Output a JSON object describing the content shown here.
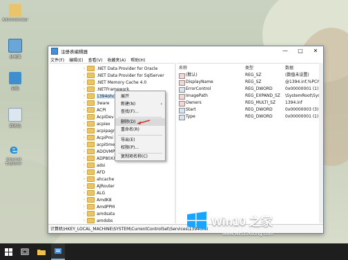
{
  "desktop": {
    "icons": [
      {
        "label": "Administrator"
      },
      {
        "label": "此电脑"
      },
      {
        "label": "网络"
      },
      {
        "label": "回收站"
      },
      {
        "label": "Internet Explorer"
      }
    ]
  },
  "window": {
    "title": "注册表编辑器",
    "controls": {
      "minimize": "—",
      "maximize": "□",
      "close": "✕"
    },
    "menu": [
      "文件(F)",
      "编辑(E)",
      "查看(V)",
      "收藏夹(A)",
      "帮助(H)"
    ]
  },
  "tree": {
    "items": [
      {
        "label": ".NET Data Provider for Oracle",
        "selected": false
      },
      {
        "label": ".NET Data Provider for SqlServer",
        "selected": false
      },
      {
        "label": ".NET Memory Cache 4.0",
        "selected": false
      },
      {
        "label": ".NETFramework",
        "selected": false
      },
      {
        "label": "1394ohci",
        "selected": true
      },
      {
        "label": "3ware",
        "selected": false
      },
      {
        "label": "ACPI",
        "selected": false
      },
      {
        "label": "AcpiDev",
        "selected": false
      },
      {
        "label": "acpiex",
        "selected": false
      },
      {
        "label": "acpipagr",
        "selected": false
      },
      {
        "label": "AcpiPmi",
        "selected": false
      },
      {
        "label": "acpitime",
        "selected": false
      },
      {
        "label": "ADOVMP",
        "selected": false
      },
      {
        "label": "ADP80XX",
        "selected": false
      },
      {
        "label": "adsi",
        "selected": false
      },
      {
        "label": "AFD",
        "selected": false
      },
      {
        "label": "ahcache",
        "selected": false
      },
      {
        "label": "AJRouter",
        "selected": false
      },
      {
        "label": "ALG",
        "selected": false
      },
      {
        "label": "AmdK8",
        "selected": false
      },
      {
        "label": "AmdPPM",
        "selected": false
      },
      {
        "label": "amdsata",
        "selected": false
      },
      {
        "label": "amdsbs",
        "selected": false
      }
    ]
  },
  "values": {
    "headers": {
      "name": "名称",
      "type": "类型",
      "data": "数据"
    },
    "rows": [
      {
        "name": "(默认)",
        "type": "REG_SZ",
        "data": "(数值未设置)",
        "icon": "string-value-icon"
      },
      {
        "name": "DisplayName",
        "type": "REG_SZ",
        "data": "@1394.inf,%PCI\\",
        "icon": "string-value-icon"
      },
      {
        "name": "ErrorControl",
        "type": "REG_DWORD",
        "data": "0x00000001 (1)",
        "icon": "binary-value-icon"
      },
      {
        "name": "ImagePath",
        "type": "REG_EXPAND_SZ",
        "data": "\\SystemRoot\\Sys",
        "icon": "string-value-icon"
      },
      {
        "name": "Owners",
        "type": "REG_MULTI_SZ",
        "data": "1394.inf",
        "icon": "string-value-icon"
      },
      {
        "name": "Start",
        "type": "REG_DWORD",
        "data": "0x00000003 (3)",
        "icon": "binary-value-icon"
      },
      {
        "name": "Type",
        "type": "REG_DWORD",
        "data": "0x00000001 (1)",
        "icon": "binary-value-icon"
      }
    ]
  },
  "context_menu": {
    "items": [
      {
        "label": "展开"
      },
      {
        "label": "新建(N)",
        "submenu": "›"
      },
      {
        "label": "查找(F)..."
      },
      {
        "label": "删除(D)",
        "highlighted": true
      },
      {
        "label": "重命名(R)"
      },
      {
        "label": "导出(E)"
      },
      {
        "label": "权限(P)..."
      },
      {
        "label": "复制项名称(C)"
      }
    ]
  },
  "statusbar": {
    "path": "计算机\\HKEY_LOCAL_MACHINE\\SYSTEM\\CurrentControlSet\\Services\\1394ohci"
  },
  "watermark": {
    "brand": "Win10 之家",
    "url": "www.win10xitong.com"
  },
  "colors": {
    "accent": "#0078d7",
    "folder": "#e9c46a",
    "taskbar": "#1e1e1e",
    "arrow": "#d0302a"
  }
}
